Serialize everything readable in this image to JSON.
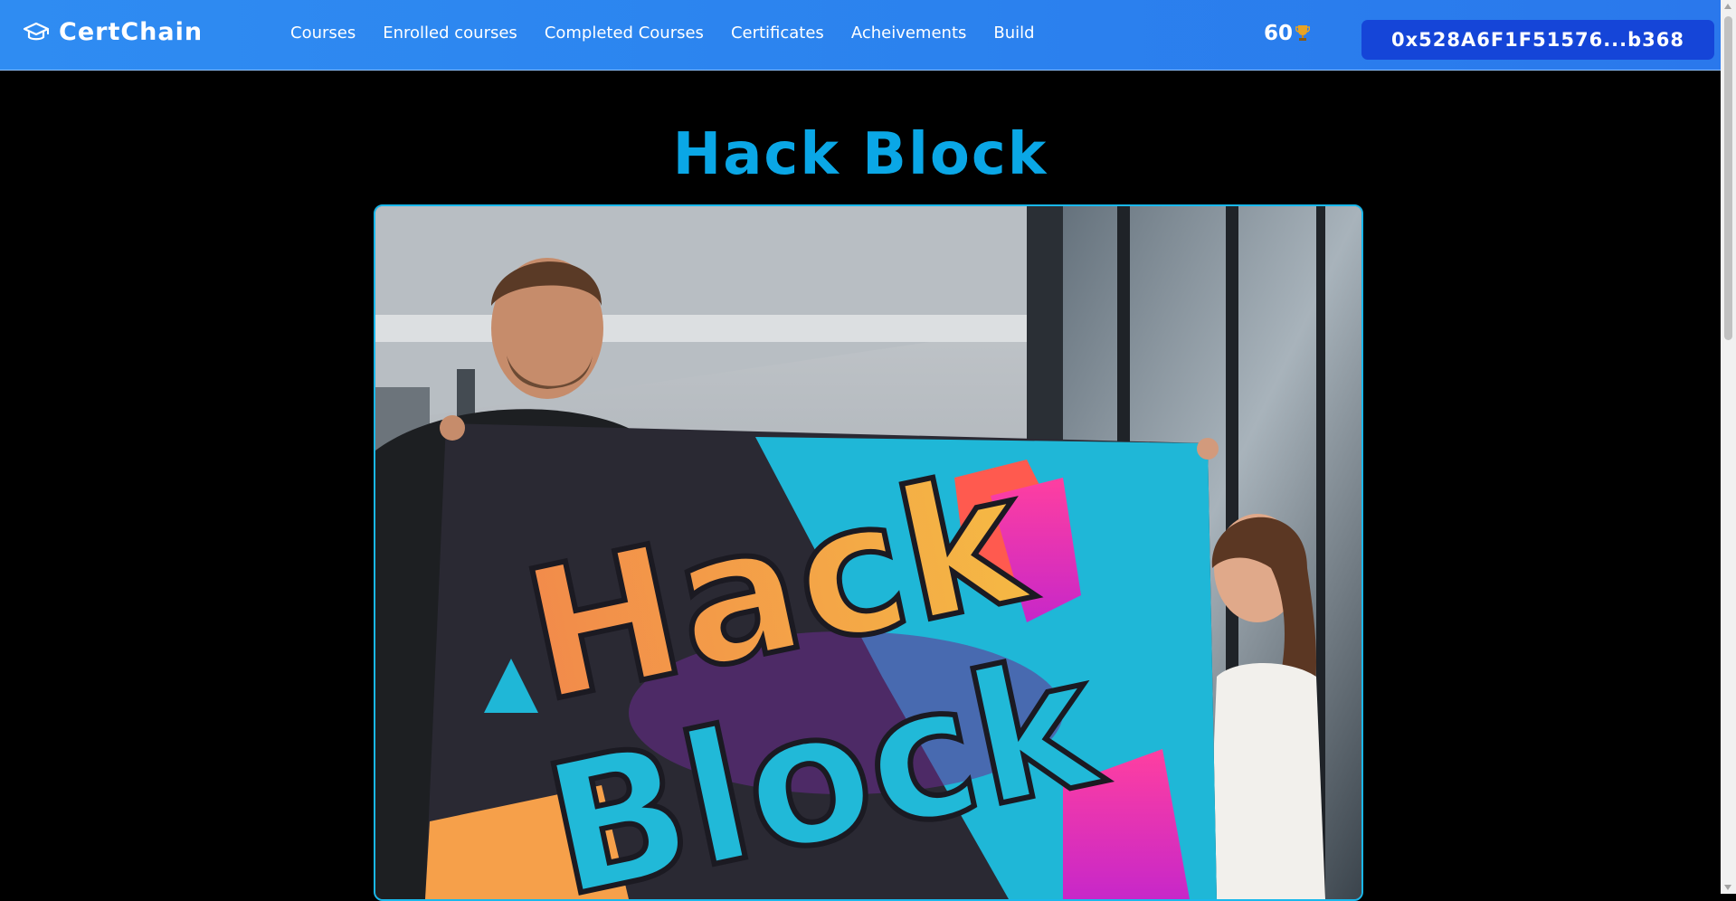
{
  "header": {
    "brand": "CertChain",
    "nav": [
      {
        "label": "Courses"
      },
      {
        "label": "Enrolled courses"
      },
      {
        "label": "Completed Courses"
      },
      {
        "label": "Certificates"
      },
      {
        "label": "Acheivements"
      },
      {
        "label": "Build"
      }
    ],
    "points": "60",
    "points_icon": "trophy-icon",
    "wallet_address": "0x528A6F1F51576...b368"
  },
  "main": {
    "title": "Hack Block",
    "hero_image": {
      "banner_text_line1": "Hack",
      "banner_text_line2": "Block"
    }
  },
  "colors": {
    "header_bg": "#2b82ee",
    "wallet_bg": "#1545d8",
    "title": "#0aa7e6",
    "hero_border": "#19b8ec",
    "page_bg": "#000000"
  }
}
